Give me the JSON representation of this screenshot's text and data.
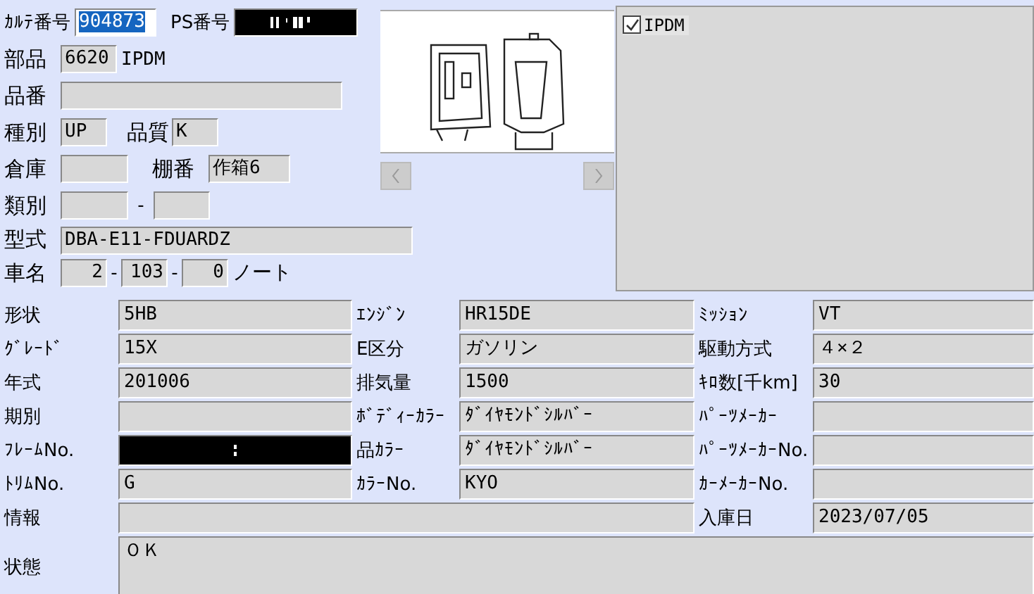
{
  "karte": {
    "label": "ｶﾙﾃ番号",
    "value": "904873",
    "selected": true
  },
  "ps": {
    "label": "PS番号",
    "masked": true
  },
  "part": {
    "label": "部品",
    "code": "6620",
    "name": "IPDM"
  },
  "part_no": {
    "label": "品番"
  },
  "kind": {
    "label": "種別",
    "value": "UP"
  },
  "quality": {
    "label": "品質",
    "value": "K"
  },
  "warehouse": {
    "label": "倉庫"
  },
  "shelf": {
    "label": "棚番",
    "value": "作箱6"
  },
  "category": {
    "label": "類別",
    "separator": "-"
  },
  "model": {
    "label": "型式",
    "value": "DBA-E11-FDUARDZ"
  },
  "car_name": {
    "label": "車名",
    "codes": [
      "2",
      "103",
      "0"
    ],
    "separators": [
      "-",
      "-"
    ],
    "name": "ノート"
  },
  "items_panel": {
    "items": [
      {
        "label": "IPDM",
        "checked": true
      }
    ]
  },
  "details": [
    [
      {
        "label": "形状",
        "value": "5HB"
      },
      {
        "label": "ｴﾝｼﾞﾝ",
        "value": "HR15DE"
      },
      {
        "label": "ﾐｯｼｮﾝ",
        "value": "VT"
      }
    ],
    [
      {
        "label": "ｸﾞﾚｰﾄﾞ",
        "value": "15X"
      },
      {
        "label": "E区分",
        "value": "ガソリン"
      },
      {
        "label": "駆動方式",
        "value": "４×２"
      }
    ],
    [
      {
        "label": "年式",
        "value": "201006"
      },
      {
        "label": "排気量",
        "value": "1500"
      },
      {
        "label": "ｷﾛ数[千km]",
        "value": "30"
      }
    ],
    [
      {
        "label": "期別"
      },
      {
        "label": "ﾎﾞﾃﾞｨｰｶﾗｰ",
        "value": "ﾀﾞｲﾔﾓﾝﾄﾞｼﾙﾊﾞｰ"
      },
      {
        "label": "ﾊﾟｰﾂﾒｰｶｰ"
      }
    ],
    [
      {
        "label": "ﾌﾚｰﾑNo.",
        "masked": true
      },
      {
        "label": "品ｶﾗｰ",
        "value": "ﾀﾞｲﾔﾓﾝﾄﾞｼﾙﾊﾞｰ"
      },
      {
        "label": "ﾊﾟｰﾂﾒｰｶｰNo."
      }
    ],
    [
      {
        "label": "ﾄﾘﾑNo.",
        "value": "G"
      },
      {
        "label": "ｶﾗｰNo.",
        "value": "KYO"
      },
      {
        "label": "ｶｰﾒｰｶｰNo."
      }
    ]
  ],
  "info": {
    "label": "情報"
  },
  "arrival": {
    "label": "入庫日",
    "value": "2023/07/05"
  },
  "status": {
    "label": "状態",
    "value": "ＯＫ"
  }
}
